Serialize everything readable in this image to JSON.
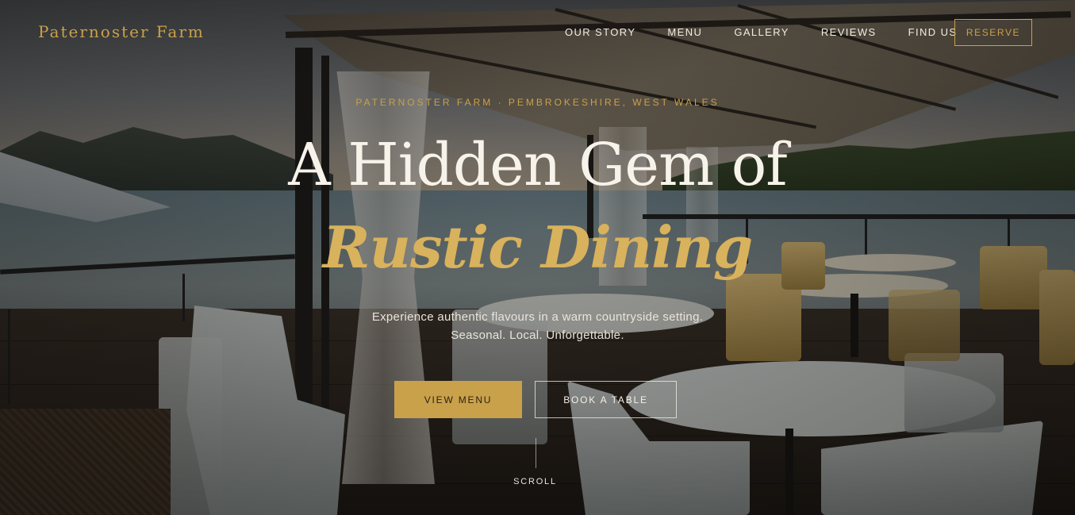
{
  "nav": {
    "brand": "Paternoster Farm",
    "links": [
      "OUR STORY",
      "MENU",
      "GALLERY",
      "REVIEWS",
      "FIND US"
    ],
    "reserve_label": "RESERVE"
  },
  "hero": {
    "eyebrow": "PATERNOSTER FARM · PEMBROKESHIRE, WEST WALES",
    "headline_line1": "A Hidden Gem of",
    "headline_line2": "Rustic Dining",
    "subtitle_line1": "Experience authentic flavours in a warm countryside setting.",
    "subtitle_line2": "Seasonal. Local. Unforgettable.",
    "primary_button": "VIEW MENU",
    "secondary_button": "BOOK A TABLE",
    "scroll_label": "SCROLL"
  },
  "colors": {
    "accent_gold": "#c9a14a",
    "headline_italic": "#d8b25c",
    "text_light": "#f7f3ea"
  }
}
